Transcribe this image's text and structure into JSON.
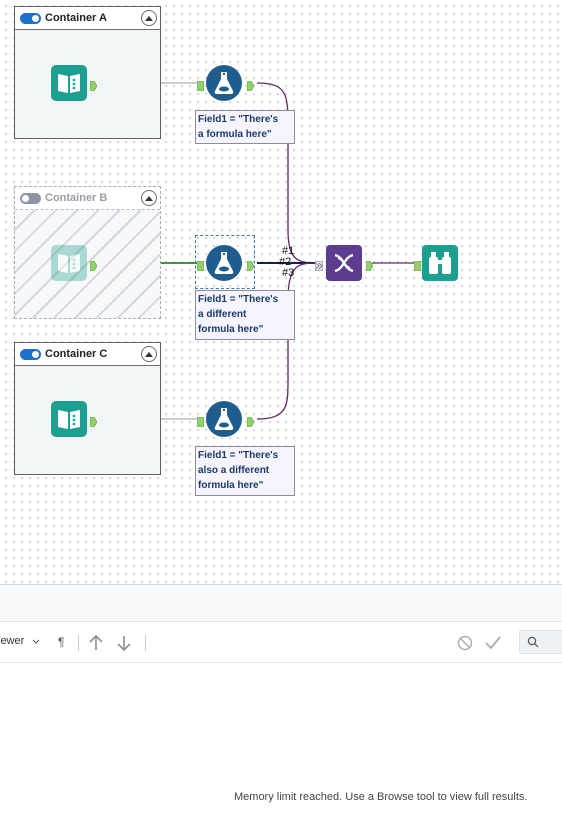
{
  "containers": [
    {
      "id": "a",
      "title": "Container A",
      "enabled": true
    },
    {
      "id": "b",
      "title": "Container B",
      "enabled": false
    },
    {
      "id": "c",
      "title": "Container C",
      "enabled": true
    }
  ],
  "annotations": {
    "formula1": "Field1 = \"There's\na formula here\"",
    "formula2": "Field1 = \"There's\na different\nformula here\"",
    "formula3": "Field1 = \"There's\nalso a different\nformula here\""
  },
  "union_inputs": [
    "#1",
    "#2",
    "#3"
  ],
  "icons": {
    "input": "book-input-icon",
    "formula": "flask-formula-icon",
    "union": "dna-union-icon",
    "browse": "binoculars-browse-icon"
  },
  "colors": {
    "input_tool": "#1e9e8f",
    "formula_tool": "#1f5d8f",
    "union_tool": "#5b3c8f",
    "browse_tool": "#1e9e8f",
    "anchor": "#8fd16a",
    "toggle_on": "#1a73c8",
    "toggle_off": "#8d95a5"
  },
  "results": {
    "viewer_label": "iewer",
    "pilcrow": "¶",
    "status": "Memory limit reached. Use a Browse tool to view full results."
  }
}
